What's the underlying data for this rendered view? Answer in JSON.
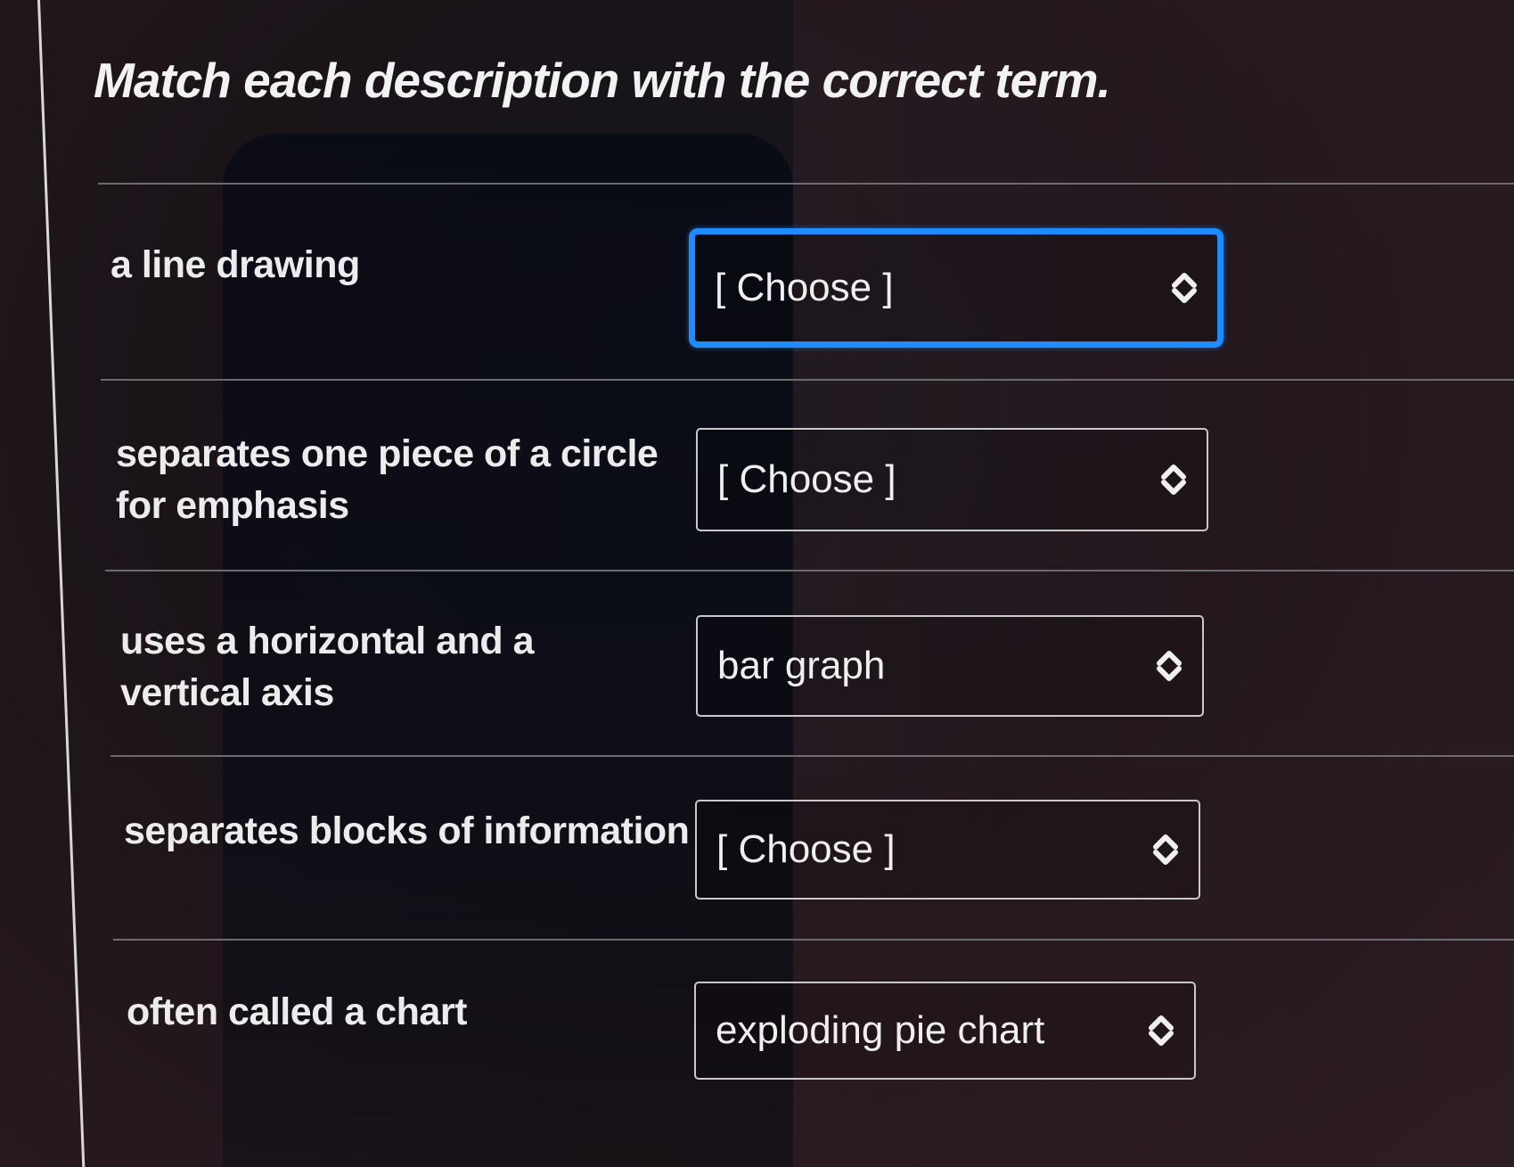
{
  "question": {
    "title": "Match each description with the correct term."
  },
  "rows": [
    {
      "description": "a line drawing",
      "selected": "[ Choose ]"
    },
    {
      "description": "separates one piece of a circle for emphasis",
      "selected": "[ Choose ]"
    },
    {
      "description": "uses a horizontal and a vertical axis",
      "selected": "bar graph"
    },
    {
      "description": "separates blocks of information",
      "selected": "[ Choose ]"
    },
    {
      "description": "often called a chart",
      "selected": "exploding pie chart"
    }
  ],
  "colors": {
    "focus_ring": "#1e8cff",
    "text": "#ececec",
    "divider": "#6b6b70"
  },
  "icons": {
    "select_indicator": "chevron-up-down-icon"
  }
}
